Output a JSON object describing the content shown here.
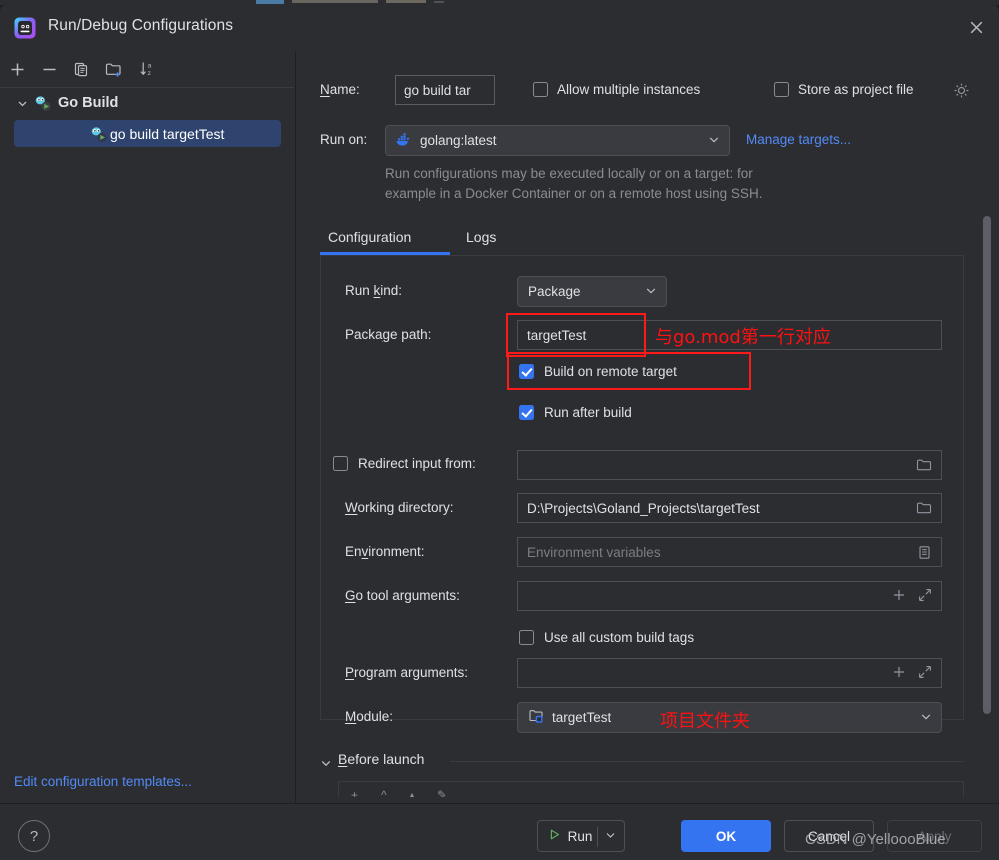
{
  "window": {
    "title": "Run/Debug Configurations",
    "app_icon": "goland-icon",
    "close_icon": "close-icon"
  },
  "left_panel": {
    "toolbar": [
      {
        "name": "add-configuration-button",
        "icon": "plus-icon"
      },
      {
        "name": "remove-configuration-button",
        "icon": "minus-icon"
      },
      {
        "name": "copy-configuration-button",
        "icon": "copy-icon"
      },
      {
        "name": "new-folder-button",
        "icon": "new-folder-icon"
      },
      {
        "name": "sort-configurations-button",
        "icon": "sort-alphabetical-icon"
      }
    ],
    "tree": {
      "group_label": "Go Build",
      "group_icon": "go-build-icon",
      "chevron": "chevron-down-icon",
      "item_label": "go build targetTest",
      "item_icon": "go-build-icon"
    },
    "edit_templates_link": "Edit configuration templates..."
  },
  "form": {
    "name_label": "Name:",
    "name_value": "go build tar",
    "allow_multiple_label": "Allow multiple instances",
    "allow_multiple_checked": false,
    "store_project_label": "Store as project file",
    "store_project_checked": false,
    "store_project_gear_icon": "gear-icon",
    "run_on_label": "Run on:",
    "run_on_value": "golang:latest",
    "run_on_icon": "docker-icon",
    "manage_targets_link": "Manage targets...",
    "hint_line1": "Run configurations may be executed locally or on a target: for",
    "hint_line2": "example in a Docker Container or on a remote host using SSH."
  },
  "tabs": [
    {
      "label": "Configuration",
      "active": true
    },
    {
      "label": "Logs",
      "active": false
    }
  ],
  "configuration": {
    "run_kind_label": "Run kind:",
    "run_kind_value": "Package",
    "package_path_label": "Package path:",
    "package_path_value": "targetTest",
    "package_path_annotation": "与go.mod第一行对应",
    "build_remote_label": "Build on remote target",
    "build_remote_checked": true,
    "run_after_build_label": "Run after build",
    "run_after_build_checked": true,
    "redirect_input_label": "Redirect input from:",
    "redirect_input_checked": false,
    "redirect_input_value": "",
    "working_directory_label": "Working directory:",
    "working_directory_value": "D:\\Projects\\Goland_Projects\\targetTest",
    "environment_label": "Environment:",
    "environment_placeholder": "Environment variables",
    "go_tool_args_label": "Go tool arguments:",
    "go_tool_args_value": "",
    "custom_build_tags_label": "Use all custom build tags",
    "custom_build_tags_checked": false,
    "program_args_label": "Program arguments:",
    "program_args_value": "",
    "module_label": "Module:",
    "module_value": "targetTest",
    "module_icon": "module-folder-icon",
    "module_annotation": "项目文件夹"
  },
  "before_launch": {
    "label": "Before launch",
    "chevron": "chevron-down-icon"
  },
  "footer": {
    "help_icon": "help-icon",
    "run_label": "Run",
    "run_icon": "play-icon",
    "ok_label": "OK",
    "cancel_label": "Cancel",
    "apply_label": "Apply",
    "apply_disabled": true
  },
  "watermark": "CSDN @YelloooBlue",
  "colors": {
    "accent": "#3574f0",
    "link": "#548af7",
    "annotation_red": "#ff1111",
    "selection": "#2e436e",
    "background": "#2b2d30"
  }
}
